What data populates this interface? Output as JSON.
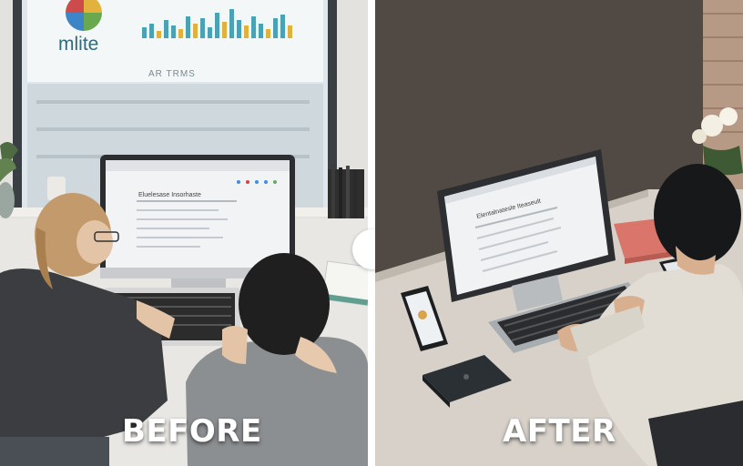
{
  "labels": {
    "before": "BEFORE",
    "after": "AFTER"
  },
  "before_scene": {
    "window_logo_text": "mlite",
    "window_banner_text": "AR TRMS",
    "monitor_heading": "Eluelesase Insorhaste"
  },
  "after_scene": {
    "monitor_heading": "Elentalnatesle Iteaseult"
  }
}
